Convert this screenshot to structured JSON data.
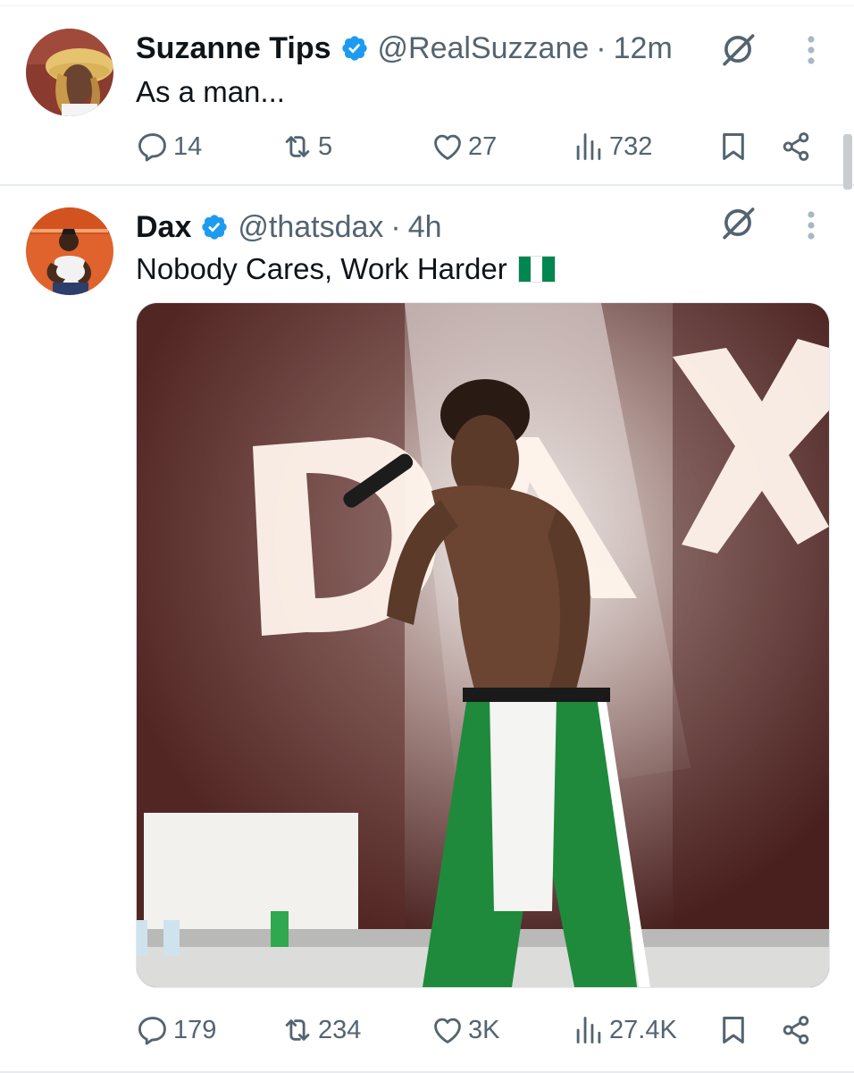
{
  "colors": {
    "text": "#0f1419",
    "secondary": "#536471",
    "verified": "#1d9bf0",
    "divider": "#e7ecee",
    "flag_green": "#008751",
    "flag_white": "#ffffff"
  },
  "tweets": [
    {
      "name": "Suzanne Tips",
      "verified": true,
      "handle": "@RealSuzzane",
      "dot": "·",
      "time": "12m",
      "text": "As a man...",
      "stats": {
        "replies": "14",
        "reposts": "5",
        "likes": "27",
        "views": "732"
      },
      "icons": [
        "grok-icon",
        "more-icon",
        "reply-icon",
        "repost-icon",
        "like-icon",
        "views-icon",
        "bookmark-icon",
        "share-icon"
      ]
    },
    {
      "name": "Dax",
      "verified": true,
      "handle": "@thatsdax",
      "dot": "·",
      "time": "4h",
      "text": "Nobody Cares, Work Harder",
      "emoji": "nigeria-flag",
      "media": {
        "type": "photo",
        "sign_text": "DAX"
      },
      "stats": {
        "replies": "179",
        "reposts": "234",
        "likes": "3K",
        "views": "27.4K"
      },
      "icons": [
        "grok-icon",
        "more-icon",
        "reply-icon",
        "repost-icon",
        "like-icon",
        "views-icon",
        "bookmark-icon",
        "share-icon"
      ]
    }
  ]
}
